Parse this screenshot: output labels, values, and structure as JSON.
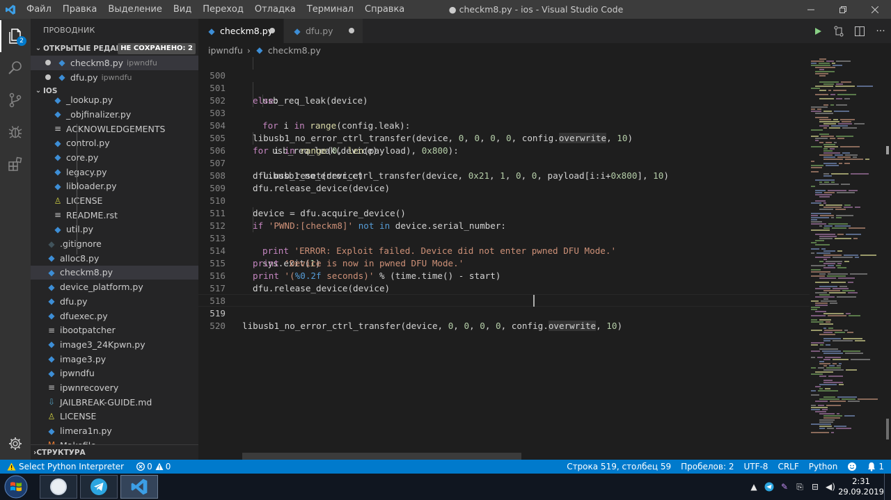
{
  "window": {
    "title": "● checkm8.py - ios - Visual Studio Code",
    "menu": [
      "Файл",
      "Правка",
      "Выделение",
      "Вид",
      "Переход",
      "Отладка",
      "Терминал",
      "Справка"
    ]
  },
  "activity_bar": {
    "items": [
      "explorer-icon",
      "search-icon",
      "source-control-icon",
      "debug-icon",
      "extensions-icon"
    ],
    "explorer_badge": "2"
  },
  "sidebar": {
    "title": "ПРОВОДНИК",
    "open_editors": {
      "header": "ОТКРЫТЫЕ РЕДАК...",
      "badge": "НЕ СОХРАНЕНО: 2",
      "items": [
        {
          "name": "checkm8.py",
          "desc": "ipwndfu"
        },
        {
          "name": "dfu.py",
          "desc": "ipwndfu"
        }
      ]
    },
    "folder": {
      "header": "IOS",
      "nested_items": [
        "_lookup.py",
        "_objfinalizer.py",
        "ACKNOWLEDGEMENTS",
        "control.py",
        "core.py",
        "legacy.py",
        "libloader.py",
        "LICENSE",
        "README.rst",
        "util.py"
      ],
      "items": [
        ".gitignore",
        "alloc8.py",
        "checkm8.py",
        "device_platform.py",
        "dfu.py",
        "dfuexec.py",
        "ibootpatcher",
        "image3_24Kpwn.py",
        "image3.py",
        "ipwndfu",
        "ipwnrecovery",
        "JAILBREAK-GUIDE.md",
        "LICENSE",
        "limera1n.py",
        "Makefile"
      ]
    },
    "structure_header": "СТРУКТУРА"
  },
  "tabs": [
    {
      "label": "checkm8.py",
      "active": true,
      "dirty": true
    },
    {
      "label": "dfu.py",
      "active": false,
      "dirty": true
    }
  ],
  "breadcrumb": {
    "folder": "ipwndfu",
    "file": "checkm8.py"
  },
  "editor": {
    "lines": [
      {
        "n": "500",
        "code": "usb_req_leak(device)"
      },
      {
        "n": "501",
        "code": "else:"
      },
      {
        "n": "502",
        "code": "for i in range(config.leak):"
      },
      {
        "n": "503",
        "code": "usb_req_leak(device)"
      },
      {
        "n": "504",
        "code": "libusb1_no_error_ctrl_transfer(device, 0, 0, 0, 0, config.overwrite, 10)"
      },
      {
        "n": "505",
        "code": "for i in range(0, len(payload), 0x800):"
      },
      {
        "n": "506",
        "code": "libusb1_no_error_ctrl_transfer(device, 0x21, 1, 0, 0, payload[i:i+0x800], 10)"
      },
      {
        "n": "507",
        "code": "dfu.usb_reset(device)"
      },
      {
        "n": "508",
        "code": "dfu.release_device(device)"
      },
      {
        "n": "509",
        "code": ""
      },
      {
        "n": "510",
        "code": "device = dfu.acquire_device()"
      },
      {
        "n": "511",
        "code": "if 'PWND:[checkm8]' not in device.serial_number:"
      },
      {
        "n": "512",
        "code": "print 'ERROR: Exploit failed. Device did not enter pwned DFU Mode.'"
      },
      {
        "n": "513",
        "code": "sys.exit(1)"
      },
      {
        "n": "514",
        "code": "print 'Device is now in pwned DFU Mode.'"
      },
      {
        "n": "515",
        "code": "print '(%0.2f seconds)' % (time.time() - start)"
      },
      {
        "n": "516",
        "code": "dfu.release_device(device)"
      },
      {
        "n": "517",
        "code": ""
      },
      {
        "n": "518",
        "code": ""
      },
      {
        "n": "519",
        "code": "libusb1_no_error_ctrl_transfer(device, 0, 0, 0, 0, config.overwrite, 10)"
      },
      {
        "n": "520",
        "code": ""
      }
    ],
    "current_line": "519"
  },
  "status_bar": {
    "interpreter": "Select Python Interpreter",
    "errors": "0",
    "warnings": "0",
    "position": "Строка 519, столбец 59",
    "spaces": "Пробелов: 2",
    "encoding": "UTF-8",
    "eol": "CRLF",
    "language": "Python"
  },
  "taskbar": {
    "apps": [
      "start-orb",
      "media-player",
      "telegram",
      "vscode"
    ],
    "time": "2:31",
    "date": "29.09.2019"
  },
  "colors": {
    "accent": "#007acc",
    "keyword": "#c586c0",
    "builtin": "#569cd6",
    "string": "#ce9178",
    "number": "#b5cea8",
    "function": "#dcdcaa"
  }
}
